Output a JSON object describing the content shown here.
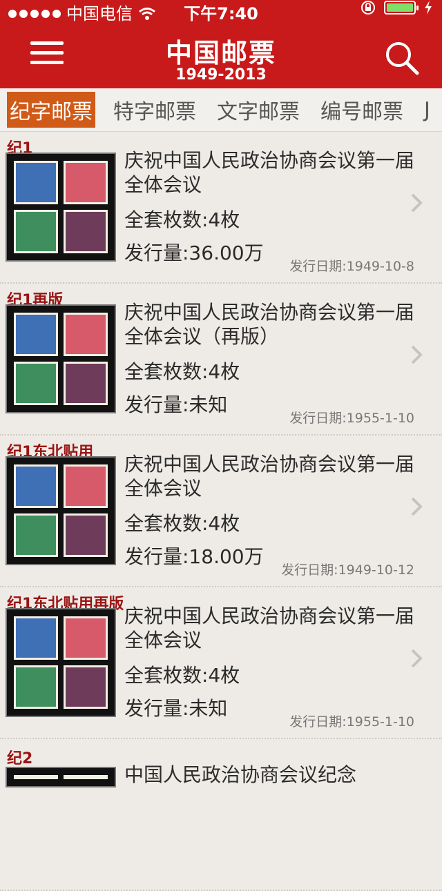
{
  "status": {
    "carrier": "中国电信",
    "time": "下午7:40"
  },
  "header": {
    "title": "中国邮票",
    "subtitle": "1949-2013"
  },
  "tabs": [
    {
      "label": "纪字邮票",
      "active": true
    },
    {
      "label": "特字邮票",
      "active": false
    },
    {
      "label": "文字邮票",
      "active": false
    },
    {
      "label": "编号邮票",
      "active": false
    },
    {
      "label": "J",
      "active": false
    }
  ],
  "items": [
    {
      "code": "纪1",
      "name": "庆祝中国人民政治协商会议第一届全体会议",
      "count": "全套枚数:4枚",
      "issue": "发行量:36.00万",
      "date": "发行日期:1949-10-8"
    },
    {
      "code": "纪1再版",
      "name": "庆祝中国人民政治协商会议第一届全体会议（再版）",
      "count": "全套枚数:4枚",
      "issue": "发行量:未知",
      "date": "发行日期:1955-1-10"
    },
    {
      "code": "纪1东北贴用",
      "name": "庆祝中国人民政治协商会议第一届全体会议",
      "count": "全套枚数:4枚",
      "issue": "发行量:18.00万",
      "date": "发行日期:1949-10-12"
    },
    {
      "code": "纪1东北贴用再版",
      "name": "庆祝中国人民政治协商会议第一届全体会议",
      "count": "全套枚数:4枚",
      "issue": "发行量:未知",
      "date": "发行日期:1955-1-10"
    },
    {
      "code": "纪2",
      "name": "中国人民政治协商会议纪念"
    }
  ],
  "icons": {
    "menu": "menu-icon",
    "search": "search-icon",
    "wifi": "wifi-icon",
    "lock": "orientation-lock-icon",
    "battery": "battery-icon",
    "chevron": "chevron-right-icon"
  }
}
